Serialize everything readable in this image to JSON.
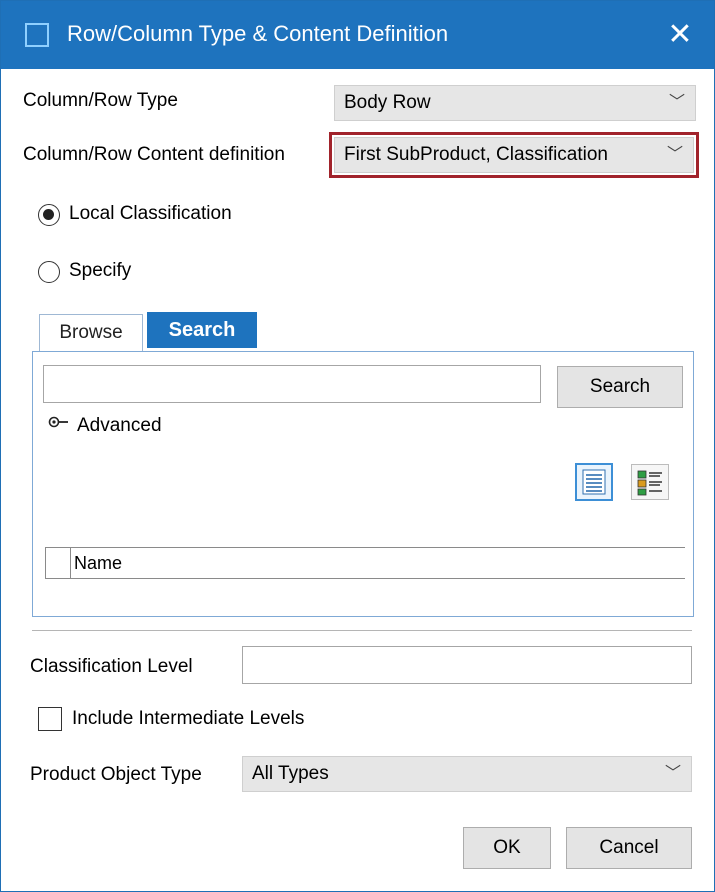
{
  "window": {
    "title": "Row/Column Type & Content Definition",
    "close": "✕"
  },
  "form": {
    "column_row_type": {
      "label": "Column/Row Type",
      "value": "Body Row"
    },
    "content_definition": {
      "label": "Column/Row Content definition",
      "value": "First SubProduct, Classification"
    },
    "radio_local": {
      "label": "Local Classification",
      "checked": true
    },
    "radio_specify": {
      "label": "Specify",
      "checked": false
    },
    "tabs": [
      {
        "label": "Browse",
        "active": false
      },
      {
        "label": "Search",
        "active": true
      }
    ],
    "search": {
      "value": "",
      "button": "Search",
      "advanced": "Advanced"
    },
    "grid": {
      "columns": [
        "Name"
      ]
    },
    "classification_level": {
      "label": "Classification Level",
      "value": ""
    },
    "include_intermediate": {
      "label": "Include Intermediate Levels",
      "checked": false
    },
    "product_object_type": {
      "label": "Product Object Type",
      "value": "All Types"
    }
  },
  "buttons": {
    "ok": "OK",
    "cancel": "Cancel"
  },
  "colors": {
    "titlebar": "#1e73be",
    "highlight_border": "#a1232b",
    "active_tab": "#1e73be"
  },
  "icons": {
    "title": "window-icon",
    "close": "close-icon",
    "chevron": "chevron-down-icon",
    "advanced": "key-toggle-icon",
    "list_view": "list-view-icon",
    "detail_view": "detail-view-icon"
  }
}
